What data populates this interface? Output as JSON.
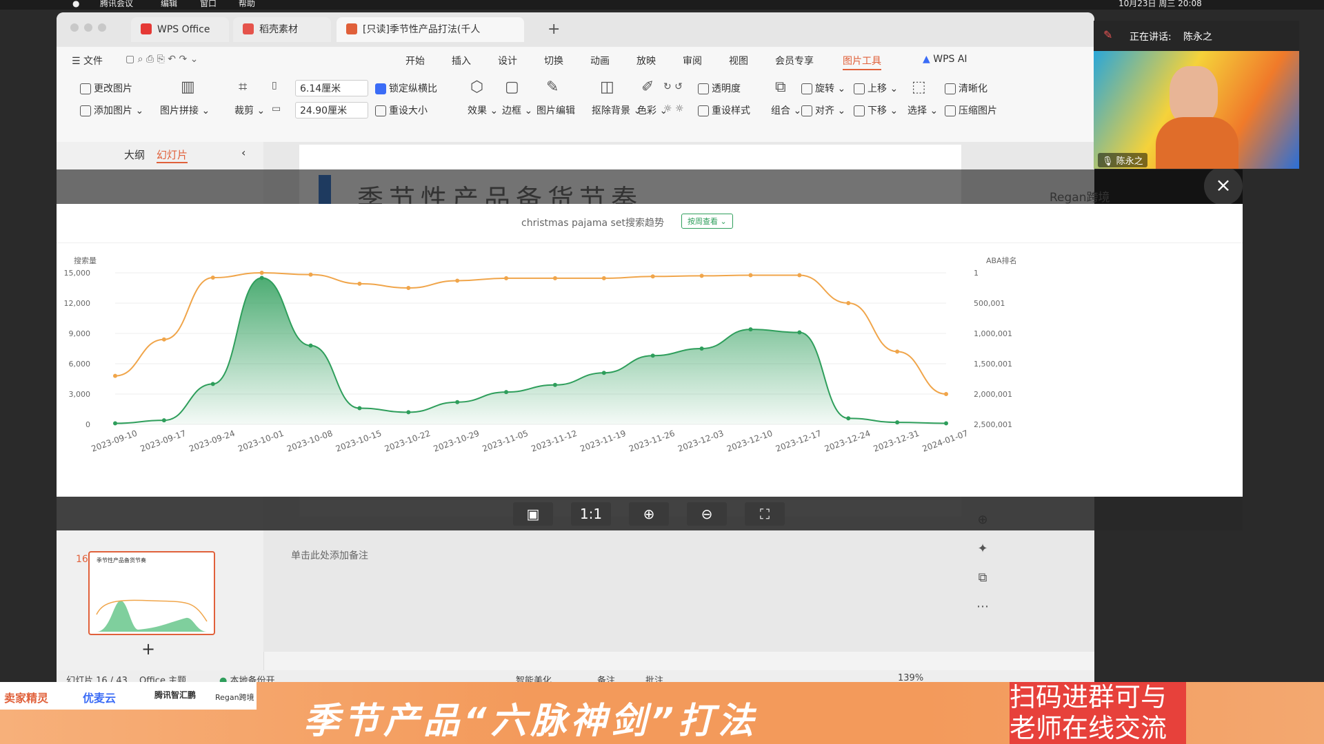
{
  "menubar": {
    "items": [
      "腾讯会议",
      "编辑",
      "窗口",
      "帮助"
    ],
    "datetime": "10月23日 周三 20:08"
  },
  "tabs": [
    {
      "label": "WPS Office"
    },
    {
      "label": "稻壳素材"
    },
    {
      "label": "[只读]季节性产品打法(千人"
    }
  ],
  "file_menu": "文件",
  "main_menu": [
    "开始",
    "插入",
    "设计",
    "切换",
    "动画",
    "放映",
    "审阅",
    "视图",
    "会员专享",
    "图片工具",
    "WPS AI"
  ],
  "ribbon": {
    "change_image": "更改图片",
    "add_image": "添加图片",
    "image_collage": "图片拼接",
    "crop": "裁剪",
    "width": "6.14厘米",
    "height": "24.90厘米",
    "lock_ratio": "锁定纵横比",
    "reset_size": "重设大小",
    "effects": "效果",
    "border": "边框",
    "edit_image": "图片编辑",
    "remove_bg": "抠除背景",
    "color": "色彩",
    "transparency": "透明度",
    "reset_style": "重设样式",
    "group": "组合",
    "rotate": "旋转",
    "align": "对齐",
    "bring_forward": "上移",
    "send_backward": "下移",
    "select": "选择",
    "sharpen": "清晰化",
    "compress": "压缩图片"
  },
  "left_panel": {
    "outline_tab": "大纲",
    "slides_tab": "幻灯片",
    "slide_number": "16",
    "thumb_title": "季节性产品备货节奏",
    "add": "+"
  },
  "slide": {
    "title": "季节性产品备货节奏",
    "logo": "Regan跨境"
  },
  "notes_placeholder": "单击此处添加备注",
  "status": {
    "slide_count": "幻灯片 16 / 43",
    "theme": "Office 主题",
    "backup": "本地备份开",
    "beautify": "智能美化",
    "notes": "备注",
    "comments": "批注",
    "zoom": "139%"
  },
  "viewer": {
    "close_icon": "×",
    "buttons": [
      "1:1"
    ]
  },
  "webcam": {
    "speaking_label": "正在讲话:",
    "speaker": "陈永之",
    "name_tag": "陈永之"
  },
  "banner": {
    "title": "季节产品“六脉神剑”打法",
    "qr_text": "扫码进群可与老师在线交流",
    "sponsors": [
      "卖家精灵",
      "优麦云",
      "腾讯智汇鹏",
      "Regan跨境"
    ]
  },
  "chart_data": {
    "type": "line",
    "title": "christmas pajama set搜索趋势",
    "filter_button": "按周查看",
    "ylabel": "搜索量",
    "y2label": "ABA排名",
    "ylim": [
      0,
      15000
    ],
    "y2lim": [
      2500001,
      1
    ],
    "yticks": [
      "0",
      "3,000",
      "6,000",
      "9,000",
      "12,000",
      "15,000"
    ],
    "y2ticks": [
      "2,500,001",
      "2,000,001",
      "1,500,001",
      "1,000,001",
      "500,001",
      "1"
    ],
    "x": [
      "2023-09-10",
      "2023-09-17",
      "2023-09-24",
      "2023-10-01",
      "2023-10-08",
      "2023-10-15",
      "2023-10-22",
      "2023-10-29",
      "2023-11-05",
      "2023-11-12",
      "2023-11-19",
      "2023-11-26",
      "2023-12-03",
      "2023-12-10",
      "2023-12-17",
      "2023-12-24",
      "2023-12-31",
      "2024-01-07"
    ],
    "series": [
      {
        "values": [
          100,
          400,
          4000,
          14500,
          7800,
          1600,
          1200,
          2200,
          3200,
          3900,
          5100,
          6800,
          7500,
          9400,
          9100,
          600,
          200,
          100
        ],
        "color": "#2e9e5b",
        "fill": true
      },
      {
        "axis": "right",
        "values": [
          1700000,
          1100000,
          80000,
          1,
          30000,
          180000,
          250000,
          130000,
          90000,
          90000,
          90000,
          60000,
          50000,
          40000,
          40000,
          500000,
          1300000,
          2000000
        ],
        "color": "#f0a54a"
      }
    ]
  }
}
